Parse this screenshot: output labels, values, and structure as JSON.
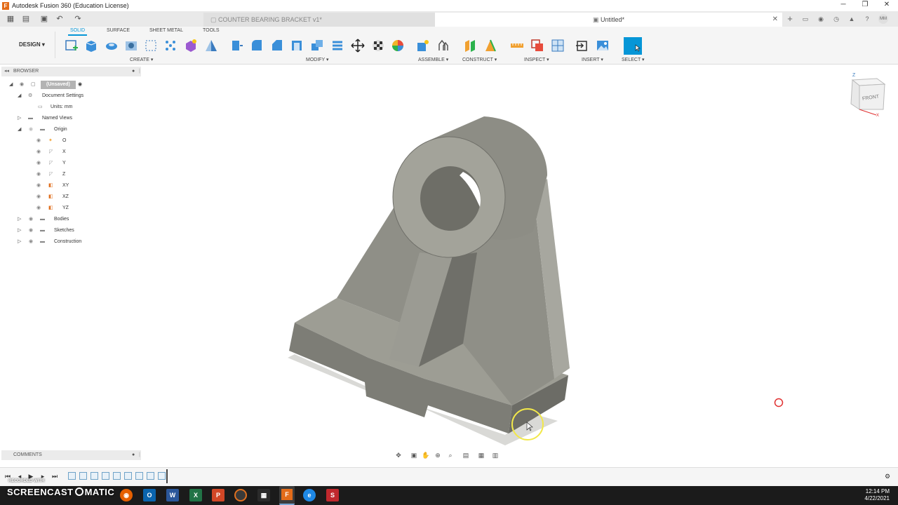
{
  "window": {
    "title": "Autodesk Fusion 360 (Education License)",
    "minimize": "─",
    "restore": "❐",
    "close": "✕"
  },
  "tabs": {
    "inactive_tab_title": "COUNTER BEARING BRACKET v1*",
    "active_tab_title": "Untitled*",
    "close_glyph": "✕",
    "new_tab_glyph": "+"
  },
  "toolbar": {
    "workspace_label": "DESIGN",
    "tabs": [
      "SOLID",
      "SURFACE",
      "SHEET METAL",
      "TOOLS"
    ],
    "active_tab": "SOLID",
    "groups": [
      "CREATE",
      "MODIFY",
      "ASSEMBLE",
      "CONSTRUCT",
      "INSPECT",
      "INSERT",
      "SELECT"
    ],
    "accent_color": "#0696d7"
  },
  "browser": {
    "header": "BROWSER",
    "items": [
      {
        "label": "(Unsaved)",
        "icon": "document-icon",
        "type": "root"
      },
      {
        "label": "Document Settings",
        "icon": "gear-icon",
        "type": "folder"
      },
      {
        "label": "Units: mm",
        "icon": "units-icon",
        "type": "leaf"
      },
      {
        "label": "Named Views",
        "icon": "folder-icon",
        "type": "folder"
      },
      {
        "label": "Origin",
        "icon": "folder-icon",
        "type": "folder"
      },
      {
        "label": "O",
        "icon": "origin-point-icon",
        "type": "leaf"
      },
      {
        "label": "X",
        "icon": "axis-icon",
        "type": "leaf"
      },
      {
        "label": "Y",
        "icon": "axis-icon",
        "type": "leaf"
      },
      {
        "label": "Z",
        "icon": "axis-icon",
        "type": "leaf"
      },
      {
        "label": "XY",
        "icon": "plane-icon",
        "type": "leaf"
      },
      {
        "label": "XZ",
        "icon": "plane-icon",
        "type": "leaf"
      },
      {
        "label": "YZ",
        "icon": "plane-icon",
        "type": "leaf"
      },
      {
        "label": "Bodies",
        "icon": "folder-icon",
        "type": "folder"
      },
      {
        "label": "Sketches",
        "icon": "folder-icon",
        "type": "folder"
      },
      {
        "label": "Construction",
        "icon": "folder-icon",
        "type": "folder"
      }
    ]
  },
  "viewcube": {
    "face_label": "FRONT",
    "axis_z": "Z",
    "axis_x": "X"
  },
  "comments": {
    "header": "COMMENTS"
  },
  "taskbar": {
    "brand": "SCREENCAST",
    "brand_suffix": "MATIC",
    "recorded_label": "RECORDED WITH",
    "time": "12:14 PM",
    "date": "4/22/2021"
  },
  "colors": {
    "model_face_light": "#a3a39a",
    "model_face_mid": "#8c8c83",
    "model_face_dark": "#6e6e67",
    "highlight_ring": "#f2e84a",
    "marker_red": "#e03030"
  }
}
